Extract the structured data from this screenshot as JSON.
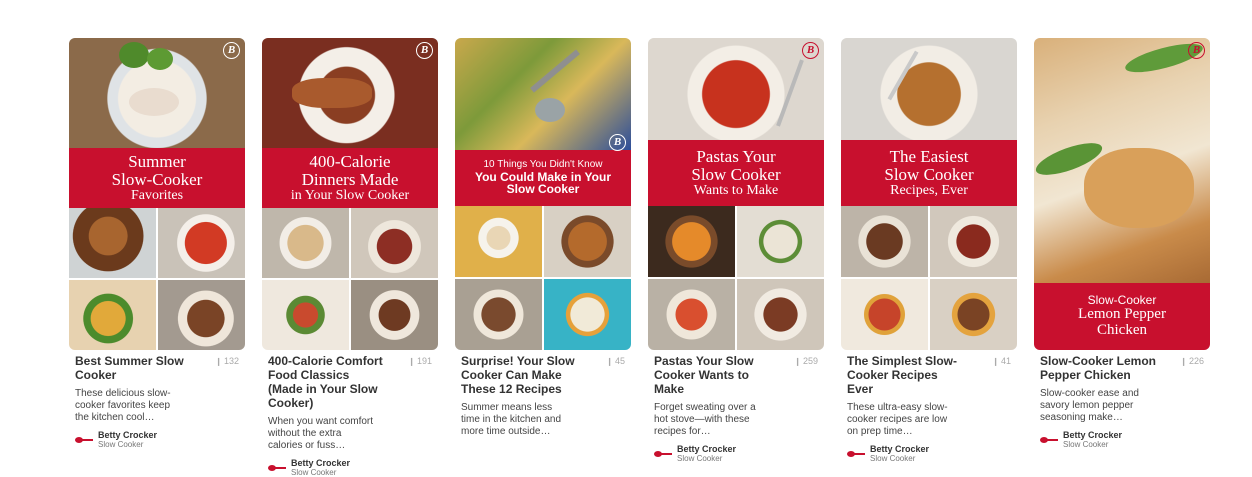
{
  "top_text": "",
  "pins": [
    {
      "banner": [
        "Summer",
        "Slow-Cooker",
        "Favorites"
      ],
      "title": "Best Summer Slow Cooker",
      "repins": "132",
      "description": "These delicious slow-cooker favorites keep the kitchen cool…",
      "pinner": "Betty Crocker",
      "board": "Slow Cooker"
    },
    {
      "banner": [
        "400-Calorie",
        "Dinners Made",
        "in Your Slow Cooker"
      ],
      "title": "400-Calorie Comfort Food Classics (Made in Your Slow Cooker)",
      "repins": "191",
      "description": "When you want comfort without the extra calories or fuss…",
      "pinner": "Betty Crocker",
      "board": "Slow Cooker"
    },
    {
      "banner": [
        "10 Things You Didn't Know",
        "You Could Make in Your",
        "Slow Cooker"
      ],
      "title": "Surprise! Your Slow Cooker Can Make These 12 Recipes",
      "repins": "45",
      "description": "Summer means less time in the kitchen and more time outside…",
      "pinner": "Betty Crocker",
      "board": "Slow Cooker"
    },
    {
      "banner": [
        "Pastas Your",
        "Slow Cooker",
        "Wants to Make"
      ],
      "title": "Pastas Your Slow Cooker Wants to Make",
      "repins": "259",
      "description": "Forget sweating over a hot stove—with these recipes for…",
      "pinner": "Betty Crocker",
      "board": "Slow Cooker"
    },
    {
      "banner": [
        "The Easiest",
        "Slow Cooker",
        "Recipes, Ever"
      ],
      "title": "The Simplest Slow-Cooker Recipes Ever",
      "repins": "41",
      "description": "These ultra-easy slow-cooker recipes are low on prep time…",
      "pinner": "Betty Crocker",
      "board": "Slow Cooker"
    },
    {
      "banner": [
        "Slow-Cooker",
        "Lemon Pepper",
        "Chicken"
      ],
      "title": "Slow-Cooker Lemon Pepper Chicken",
      "repins": "226",
      "description": "Slow-cooker ease and savory lemon pepper seasoning make…",
      "pinner": "Betty Crocker",
      "board": "Slow Cooker"
    }
  ],
  "badge_letter": "B",
  "colors": {
    "brand_red": "#c8102e",
    "text": "#333333",
    "muted": "#aaaaaa"
  },
  "icons": [
    "betty-crocker-spoon-icon",
    "pin-count-icon",
    "betty-crocker-badge-icon"
  ]
}
